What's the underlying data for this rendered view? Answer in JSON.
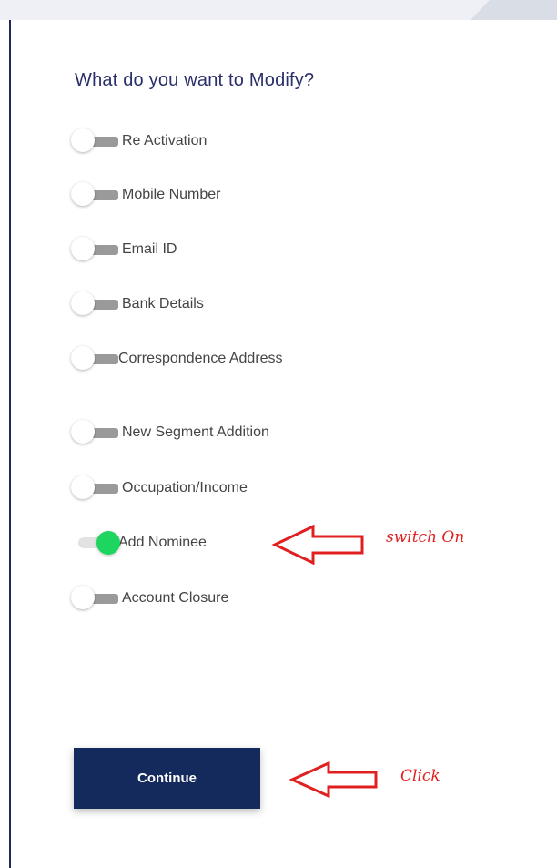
{
  "heading": "What do you want to Modify?",
  "options": [
    {
      "label": "Re Activation",
      "on": false
    },
    {
      "label": "Mobile Number",
      "on": false
    },
    {
      "label": "Email ID",
      "on": false
    },
    {
      "label": "Bank Details",
      "on": false
    },
    {
      "label": "Correspondence Address",
      "on": false
    },
    {
      "label": "New Segment Addition",
      "on": false
    },
    {
      "label": "Occupation/Income",
      "on": false
    },
    {
      "label": "Add Nominee",
      "on": true
    },
    {
      "label": "Account Closure",
      "on": false
    }
  ],
  "continue_label": "Continue",
  "annotations": {
    "switch_on": "switch On",
    "click": "Click"
  },
  "colors": {
    "accent_on": "#1ed65f",
    "button_bg": "#142a5c",
    "annotation": "#e02020"
  }
}
